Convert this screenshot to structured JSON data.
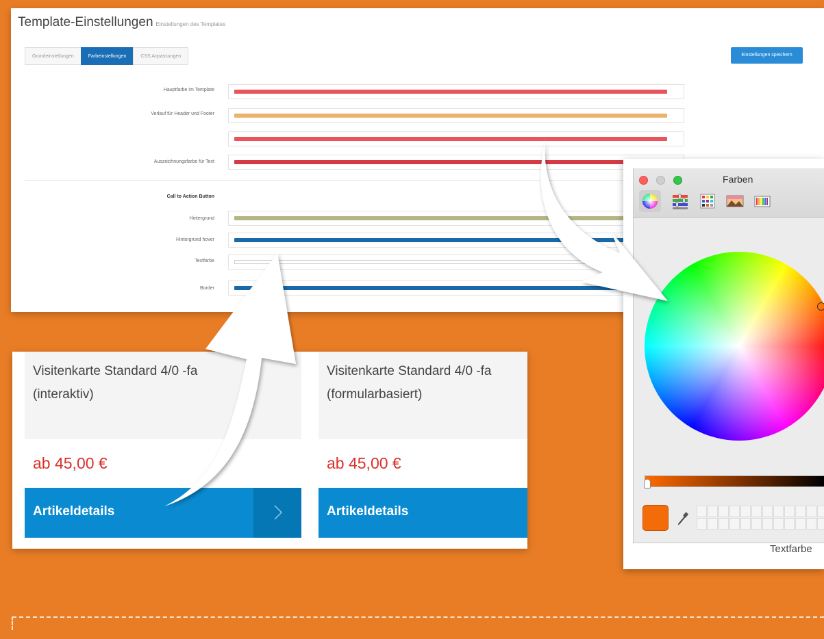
{
  "settings": {
    "title": "Template-Einstellungen",
    "subtitle": "Einstellungen des Templates",
    "tabs": [
      {
        "label": "Grundeinstellungen",
        "active": false
      },
      {
        "label": "Farbeinstellungen",
        "active": true
      },
      {
        "label": "CSS Anpassungen",
        "active": false
      }
    ],
    "save_label": "Einstellungen speichern",
    "rows": [
      {
        "label": "Hauptfarbe im Template",
        "color": "#e8555e"
      },
      {
        "label": "Verlauf für Header und Footer",
        "color": "#e9b46c"
      },
      {
        "label": "",
        "color": "#e8555e"
      },
      {
        "label": "Auszeichnungsfarbe für Text",
        "color": "#d63a45"
      }
    ],
    "cta_heading": "Call to Action Button",
    "cta_rows": [
      {
        "label": "Hintergrund",
        "color": "#b3b584"
      },
      {
        "label": "Hintergrund hover",
        "color": "#1a6aa8"
      },
      {
        "label": "Textfarbe",
        "color": "#ffffff"
      },
      {
        "label": "Border",
        "color": "#1a6aa8"
      }
    ]
  },
  "products": [
    {
      "title_line1": "Visitenkarte Standard 4/0 -fa",
      "title_line2": "(interaktiv)",
      "price": "ab 45,00 €",
      "button_label": "Artikeldetails",
      "arrow": "›"
    },
    {
      "title_line1": "Visitenkarte Standard 4/0 -fa",
      "title_line2": "(formularbasiert)",
      "price": "ab 45,00 €",
      "button_label": "Artikeldetails",
      "arrow": ""
    }
  ],
  "color_picker": {
    "title": "Farben",
    "traffic_colors": [
      "#fc605c",
      "#c8c8c8",
      "#34c749"
    ],
    "toolbar_icons": [
      "color-wheel-icon",
      "sliders-icon",
      "palettes-icon",
      "image-palette-icon",
      "pencils-icon"
    ],
    "current_color": "#f46b0a",
    "bottom_label": "Textfarbe"
  },
  "colors": {
    "background": "#e97d25",
    "accent_blue": "#0a8bd1",
    "price_red": "#d9312b"
  }
}
